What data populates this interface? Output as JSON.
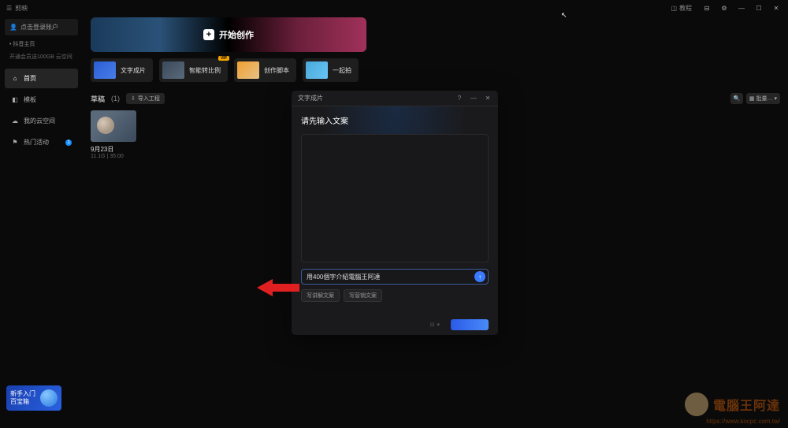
{
  "app_name": "剪映",
  "topbar": {
    "tutorial": "教程"
  },
  "sidebar": {
    "account_login": "点击登录账户",
    "account_line": "• 抖音主页",
    "storage": "开通会员送100GB 云空间",
    "nav": [
      {
        "icon": "home",
        "label": "首页",
        "active": true
      },
      {
        "icon": "template",
        "label": "模板",
        "active": false
      },
      {
        "icon": "cloud",
        "label": "我的云空间",
        "active": false
      },
      {
        "icon": "flag",
        "label": "热门活动",
        "active": false,
        "badge": "1"
      }
    ]
  },
  "main": {
    "create_label": "开始创作",
    "features": [
      {
        "label": "文字成片",
        "thumb": "thumb-1"
      },
      {
        "label": "智能转比例",
        "thumb": "thumb-2",
        "vip": true
      },
      {
        "label": "创作脚本",
        "thumb": "thumb-3"
      },
      {
        "label": "一起拍",
        "thumb": "thumb-4"
      }
    ],
    "draft_section": {
      "title": "草稿",
      "count": "(1)",
      "import": "导入工程"
    },
    "draft": {
      "name": "9月23日",
      "meta": "11.1G | 35:00"
    },
    "view_toggle": "批量…"
  },
  "modal": {
    "header": "文字成片",
    "title": "请先输入文案",
    "input_value": "用400個字介紹電腦王阿達",
    "chips": [
      "写讲解文案",
      "写营销文案"
    ]
  },
  "promo": {
    "line1": "新手入门",
    "line2": "百宝箱"
  },
  "watermark": {
    "brand": "電腦王阿達",
    "url": "https://www.kocpc.com.tw/"
  }
}
